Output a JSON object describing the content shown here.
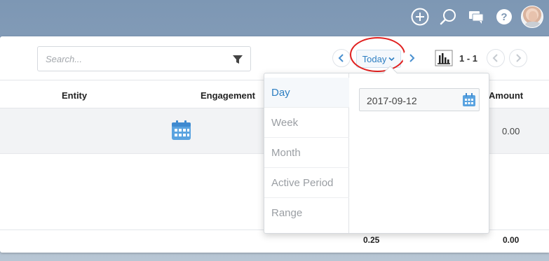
{
  "topbar": {
    "icons": [
      "plus-circle-icon",
      "search-icon",
      "chat-icon",
      "help-icon"
    ],
    "avatar_label": "user avatar"
  },
  "search": {
    "placeholder": "Search..."
  },
  "period": {
    "current_label": "Today",
    "pager": "1 - 1"
  },
  "table": {
    "headers": {
      "entity": "Entity",
      "engagement": "Engagement",
      "amount": "Amount"
    },
    "row1": {
      "amount": "0.00"
    },
    "totals": {
      "col5": "0.25",
      "amount": "0.00"
    }
  },
  "dropdown": {
    "items": [
      "Day",
      "Week",
      "Month",
      "Active Period",
      "Range"
    ],
    "active_index": 0,
    "date_value": "2017-09-12"
  },
  "colors": {
    "accent": "#2e7fc2",
    "highlight": "#e0201f",
    "calendar_blue": "#5aa3e0"
  }
}
